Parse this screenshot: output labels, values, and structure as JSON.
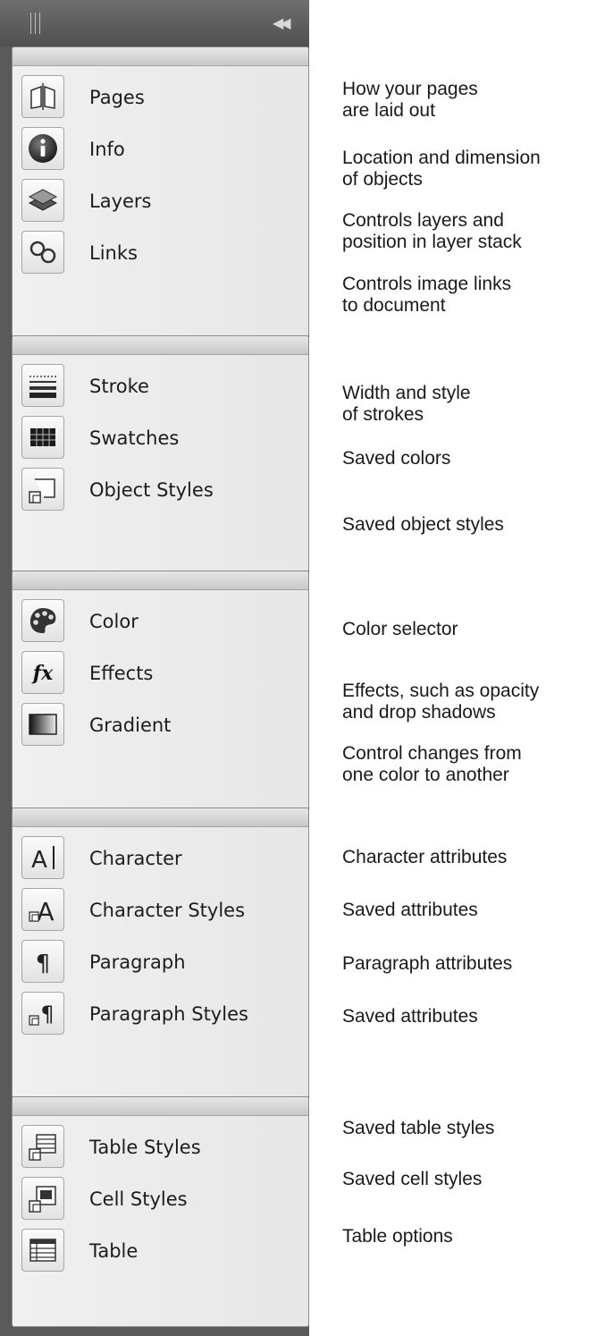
{
  "dock": {
    "collapse_glyph": "◀◀",
    "groups": [
      {
        "items": [
          {
            "label": "Pages",
            "icon": "pages-icon"
          },
          {
            "label": "Info",
            "icon": "info-icon"
          },
          {
            "label": "Layers",
            "icon": "layers-icon"
          },
          {
            "label": "Links",
            "icon": "links-icon"
          }
        ]
      },
      {
        "items": [
          {
            "label": "Stroke",
            "icon": "stroke-icon"
          },
          {
            "label": "Swatches",
            "icon": "swatches-icon"
          },
          {
            "label": "Object Styles",
            "icon": "object-styles-icon"
          }
        ]
      },
      {
        "items": [
          {
            "label": "Color",
            "icon": "color-palette-icon"
          },
          {
            "label": "Effects",
            "icon": "effects-fx-icon"
          },
          {
            "label": "Gradient",
            "icon": "gradient-icon"
          }
        ]
      },
      {
        "items": [
          {
            "label": "Character",
            "icon": "character-icon"
          },
          {
            "label": "Character Styles",
            "icon": "character-styles-icon"
          },
          {
            "label": "Paragraph",
            "icon": "paragraph-icon"
          },
          {
            "label": "Paragraph Styles",
            "icon": "paragraph-styles-icon"
          }
        ]
      },
      {
        "items": [
          {
            "label": "Table Styles",
            "icon": "table-styles-icon"
          },
          {
            "label": "Cell Styles",
            "icon": "cell-styles-icon"
          },
          {
            "label": "Table",
            "icon": "table-icon"
          }
        ]
      }
    ]
  },
  "descriptions": [
    "How your pages\nare laid out",
    "Location and dimension\nof objects",
    "Controls layers and\nposition in layer stack",
    "Controls image links\nto document",
    "Width and style\nof strokes",
    "Saved colors",
    "Saved object styles",
    "Color selector",
    "Effects, such as opacity\nand drop shadows",
    "Control changes from\none color to another",
    "Character attributes",
    "Saved attributes",
    "Paragraph attributes",
    "Saved attributes",
    "Saved table styles",
    "Saved cell styles",
    "Table options"
  ]
}
